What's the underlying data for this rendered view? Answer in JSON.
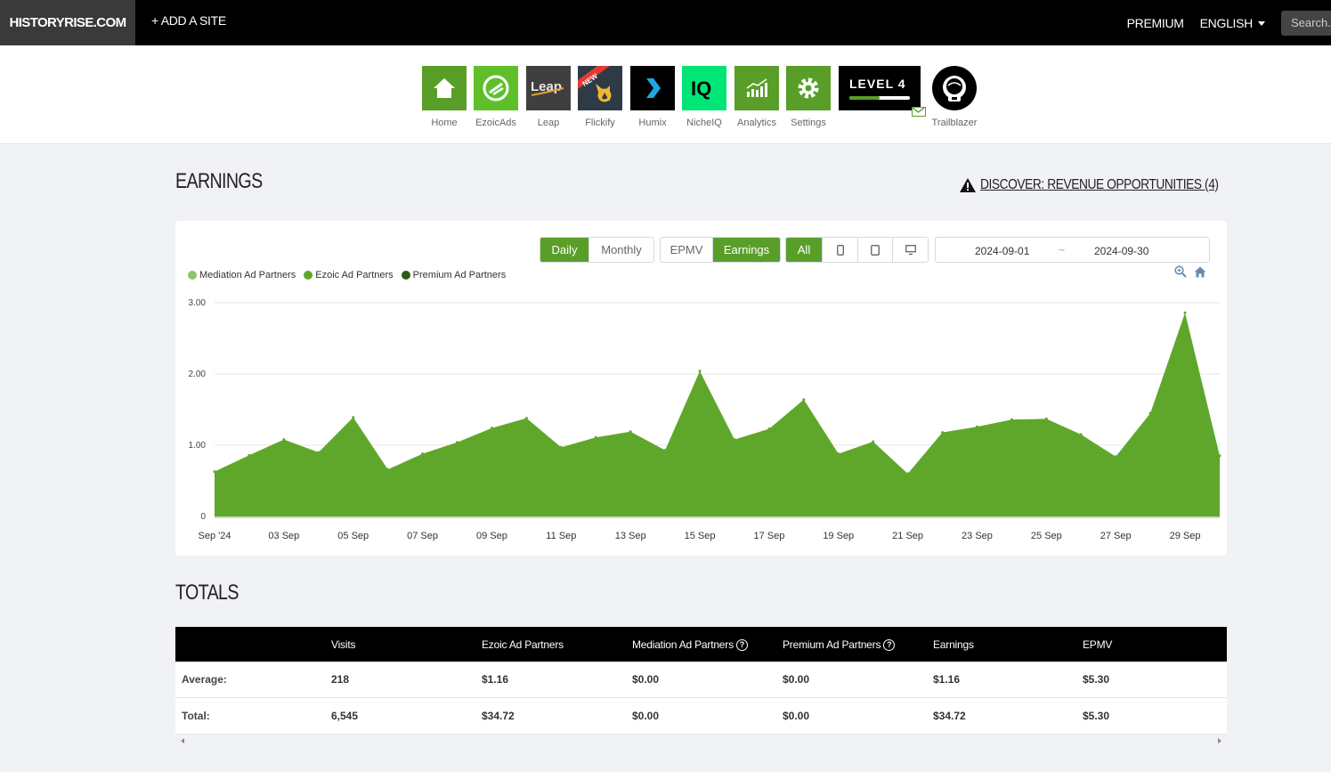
{
  "topbar": {
    "brand": "HISTORYRISE.COM",
    "add_site": "+ ADD A SITE",
    "premium": "PREMIUM",
    "language": "ENGLISH",
    "search_placeholder": "Search..."
  },
  "apps": [
    {
      "label": "Home",
      "icon": "home-icon",
      "color": "#5a9e2a"
    },
    {
      "label": "EzoicAds",
      "icon": "ezoicads-icon",
      "color": "#5fbf2b"
    },
    {
      "label": "Leap",
      "icon": "leap-icon",
      "color": "#3f3f3f",
      "text": "Leap"
    },
    {
      "label": "Flickify",
      "icon": "flickify-icon",
      "color": "#2e3a45",
      "badge": "NEW"
    },
    {
      "label": "Humix",
      "icon": "humix-icon",
      "color": "#000000"
    },
    {
      "label": "NicheIQ",
      "icon": "nicheiq-icon",
      "color": "#00e676",
      "text": "IQ"
    },
    {
      "label": "Analytics",
      "icon": "analytics-icon",
      "color": "#5a9e2a"
    },
    {
      "label": "Settings",
      "icon": "settings-icon",
      "color": "#5a9e2a"
    }
  ],
  "level": {
    "text": "LEVEL 4",
    "progress": 0.5
  },
  "trailblazer": {
    "label": "Trailblazer"
  },
  "earnings": {
    "title": "EARNINGS",
    "discover": "DISCOVER: REVENUE OPPORTUNITIES (4)"
  },
  "controls": {
    "period": [
      "Daily",
      "Monthly"
    ],
    "period_active": "Daily",
    "metric": [
      "EPMV",
      "Earnings"
    ],
    "metric_active": "Earnings",
    "device_all": "All",
    "date_start": "2024-09-01",
    "date_sep": "~",
    "date_end": "2024-09-30"
  },
  "legend": [
    {
      "name": "Mediation Ad Partners",
      "color": "#8dc46a"
    },
    {
      "name": "Ezoic Ad Partners",
      "color": "#5fa72a"
    },
    {
      "name": "Premium Ad Partners",
      "color": "#2f5a16"
    }
  ],
  "chart_data": {
    "type": "area",
    "x": [
      "2024-09-01",
      "2024-09-02",
      "2024-09-03",
      "2024-09-04",
      "2024-09-05",
      "2024-09-06",
      "2024-09-07",
      "2024-09-08",
      "2024-09-09",
      "2024-09-10",
      "2024-09-11",
      "2024-09-12",
      "2024-09-13",
      "2024-09-14",
      "2024-09-15",
      "2024-09-16",
      "2024-09-17",
      "2024-09-18",
      "2024-09-19",
      "2024-09-20",
      "2024-09-21",
      "2024-09-22",
      "2024-09-23",
      "2024-09-24",
      "2024-09-25",
      "2024-09-26",
      "2024-09-27",
      "2024-09-28",
      "2024-09-29",
      "2024-09-30"
    ],
    "x_tick_labels": [
      "Sep '24",
      "03 Sep",
      "05 Sep",
      "07 Sep",
      "09 Sep",
      "11 Sep",
      "13 Sep",
      "15 Sep",
      "17 Sep",
      "19 Sep",
      "21 Sep",
      "23 Sep",
      "25 Sep",
      "27 Sep",
      "29 Sep"
    ],
    "series": [
      {
        "name": "Ezoic Ad Partners",
        "color": "#5fa72a",
        "values": [
          0.63,
          0.86,
          1.08,
          0.9,
          1.39,
          0.66,
          0.88,
          1.04,
          1.24,
          1.38,
          0.97,
          1.11,
          1.19,
          0.93,
          2.04,
          1.08,
          1.23,
          1.64,
          0.88,
          1.05,
          0.6,
          1.18,
          1.26,
          1.36,
          1.37,
          1.15,
          0.84,
          1.45,
          2.86,
          0.85
        ]
      },
      {
        "name": "Mediation Ad Partners",
        "color": "#8dc46a",
        "values": [
          0,
          0,
          0,
          0,
          0,
          0,
          0,
          0,
          0,
          0,
          0,
          0,
          0,
          0,
          0,
          0,
          0,
          0,
          0,
          0,
          0,
          0,
          0,
          0,
          0,
          0,
          0,
          0,
          0,
          0
        ]
      },
      {
        "name": "Premium Ad Partners",
        "color": "#2f5a16",
        "values": [
          0,
          0,
          0,
          0,
          0,
          0,
          0,
          0,
          0,
          0,
          0,
          0,
          0,
          0,
          0,
          0,
          0,
          0,
          0,
          0,
          0,
          0,
          0,
          0,
          0,
          0,
          0,
          0,
          0,
          0
        ]
      }
    ],
    "y_ticks": [
      "0",
      "1.00",
      "2.00",
      "3.00"
    ],
    "ylim": [
      0,
      3
    ],
    "grid": true,
    "legend_position": "top-left"
  },
  "totals": {
    "title": "TOTALS",
    "columns": [
      "Visits",
      "Ezoic Ad Partners",
      "Mediation Ad Partners",
      "Premium Ad Partners",
      "Earnings",
      "EPMV"
    ],
    "rows": [
      {
        "label": "Average:",
        "values": [
          "218",
          "$1.16",
          "$0.00",
          "$0.00",
          "$1.16",
          "$5.30"
        ]
      },
      {
        "label": "Total:",
        "values": [
          "6,545",
          "$34.72",
          "$0.00",
          "$0.00",
          "$34.72",
          "$5.30"
        ]
      }
    ]
  }
}
